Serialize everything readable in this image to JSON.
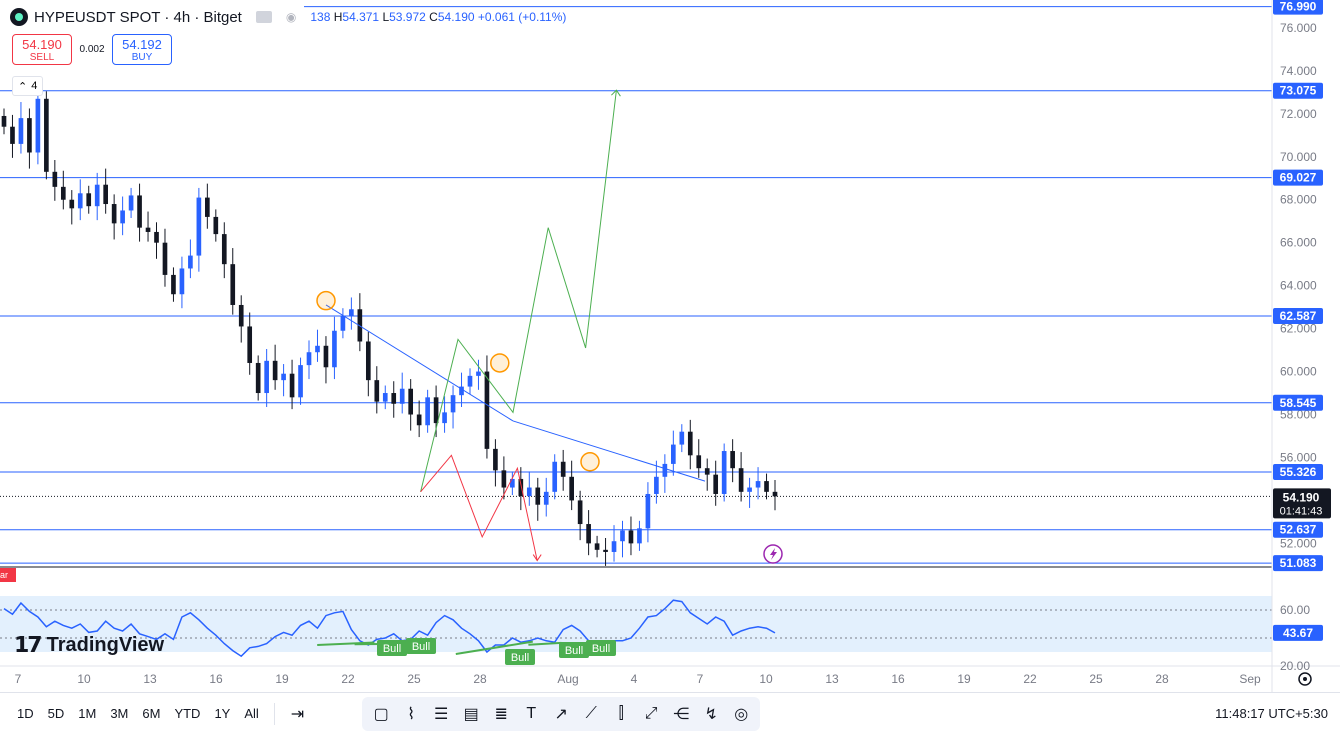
{
  "header": {
    "symbol_title": "HYPEUSDT SPOT · 4h · Bitget",
    "ohlc_text": "138",
    "high_label": "H",
    "high": "54.371",
    "low_label": "L",
    "low": "53.972",
    "close_label": "C",
    "close": "54.190",
    "change": "+0.061 (+0.11%)"
  },
  "trade": {
    "sell_price": "54.190",
    "sell_label": "SELL",
    "spread": "0.002",
    "buy_price": "54.192",
    "buy_label": "BUY"
  },
  "collapse_count": "4",
  "indicator_tag": "ar",
  "logo_text": "TradingView",
  "price_axis": {
    "ticks": [
      "76.000",
      "74.000",
      "72.000",
      "70.000",
      "68.000",
      "66.000",
      "64.000",
      "62.000",
      "60.000",
      "58.000",
      "56.000",
      "52.000"
    ],
    "level_labels": [
      "76.990",
      "73.075",
      "69.027",
      "62.587",
      "58.545",
      "55.326",
      "52.637",
      "51.083"
    ],
    "current_price": "54.190",
    "countdown": "01:41:43"
  },
  "rsi_axis": {
    "ticks": [
      "60.00",
      "20.00"
    ],
    "current": "43.67"
  },
  "time_axis": {
    "labels": [
      "7",
      "10",
      "13",
      "16",
      "19",
      "22",
      "25",
      "28",
      "Aug",
      "4",
      "7",
      "10",
      "13",
      "16",
      "19",
      "22",
      "25",
      "28",
      "Sep"
    ]
  },
  "bull_labels": [
    "Bull",
    "Bull",
    "Bull",
    "Bull",
    "Bull"
  ],
  "toolbar": {
    "ranges": [
      "1D",
      "5D",
      "1M",
      "3M",
      "6M",
      "YTD",
      "1Y",
      "All"
    ],
    "clock": "11:48:17 UTC+5:30"
  },
  "colors": {
    "up": "#2962ff",
    "down": "#131722",
    "level": "#2962ff",
    "bull_path": "#4caf50",
    "bear_path": "#f23645",
    "rsi": "#2962ff",
    "rsi_band": "#e3f0fd"
  },
  "chart_data": {
    "type": "candlestick",
    "price_range": [
      50.9,
      77.3
    ],
    "horizontal_levels": [
      76.99,
      73.075,
      69.027,
      62.587,
      58.545,
      55.326,
      52.637,
      51.083
    ],
    "current_price": 54.19,
    "trendline": [
      [
        21.0,
        63.1
      ],
      [
        29.5,
        57.7
      ]
    ],
    "close_path": [
      71.4,
      70.6,
      71.8,
      70.2,
      72.7,
      69.3,
      68.6,
      68.0,
      67.6,
      68.3,
      67.7,
      68.7,
      67.8,
      66.9,
      67.5,
      68.2,
      66.7,
      66.5,
      66.0,
      64.5,
      63.6,
      64.8,
      65.4,
      68.1,
      67.2,
      66.4,
      65.0,
      63.1,
      62.1,
      60.4,
      59.0,
      60.5,
      59.6,
      59.9,
      58.8,
      60.3,
      60.9,
      61.2,
      60.2,
      61.9,
      62.6,
      62.9,
      61.4,
      59.6,
      58.6,
      59.0,
      58.5,
      59.2,
      58.0,
      57.5,
      58.8,
      57.6,
      58.1,
      58.9,
      59.3,
      59.8,
      60.0,
      56.4,
      55.4,
      54.6,
      55.0,
      54.2,
      54.6,
      53.8,
      54.4,
      55.8,
      55.1,
      54.0,
      52.9,
      52.0,
      51.7,
      51.6,
      52.1,
      52.6,
      52.0,
      52.7,
      54.3,
      55.1,
      55.7,
      56.6,
      57.2,
      56.1,
      55.5,
      55.2,
      54.3,
      56.3,
      55.5,
      54.4,
      54.6,
      54.9,
      54.4,
      54.19
    ],
    "bull_path": [
      [
        25.3,
        54.4
      ],
      [
        27.0,
        61.5
      ],
      [
        29.5,
        58.1
      ],
      [
        31.1,
        66.7
      ],
      [
        32.8,
        61.1
      ],
      [
        34.2,
        73.1
      ]
    ],
    "bear_path": [
      [
        25.3,
        54.4
      ],
      [
        26.7,
        56.1
      ],
      [
        28.1,
        52.3
      ],
      [
        29.7,
        55.5
      ],
      [
        30.6,
        51.2
      ]
    ],
    "markers": [
      [
        21.0,
        63.3
      ],
      [
        28.9,
        60.4
      ],
      [
        33.0,
        55.8
      ]
    ],
    "rsi": {
      "range": [
        20,
        80
      ],
      "band": [
        30,
        70
      ],
      "current": 43.67,
      "values": [
        61,
        57,
        65,
        59,
        55,
        48,
        52,
        49,
        47,
        50,
        44,
        45,
        52,
        47,
        45,
        50,
        43,
        41,
        39,
        43,
        39,
        55,
        58,
        53,
        47,
        42,
        36,
        31,
        27,
        33,
        34,
        36,
        41,
        44,
        42,
        49,
        52,
        47,
        56,
        58,
        59,
        46,
        38,
        35,
        39,
        40,
        43,
        38,
        39,
        45,
        42,
        51,
        56,
        53,
        47,
        43,
        38,
        30,
        35,
        35,
        40,
        37,
        38,
        40,
        38,
        37,
        46,
        49,
        45,
        38,
        35,
        37,
        38,
        38,
        40,
        47,
        55,
        56,
        61,
        67,
        66,
        58,
        54,
        50,
        55,
        52,
        42,
        45,
        47,
        48,
        47,
        43.67
      ],
      "bull_divergences": [
        [
          20.6,
          35.0,
          23.2,
          36.8
        ],
        [
          22.3,
          35.5,
          25.3,
          36.0
        ],
        [
          26.9,
          28.6,
          30.4,
          37.4
        ],
        [
          30.2,
          35.2,
          31.7,
          36.5
        ]
      ]
    }
  }
}
